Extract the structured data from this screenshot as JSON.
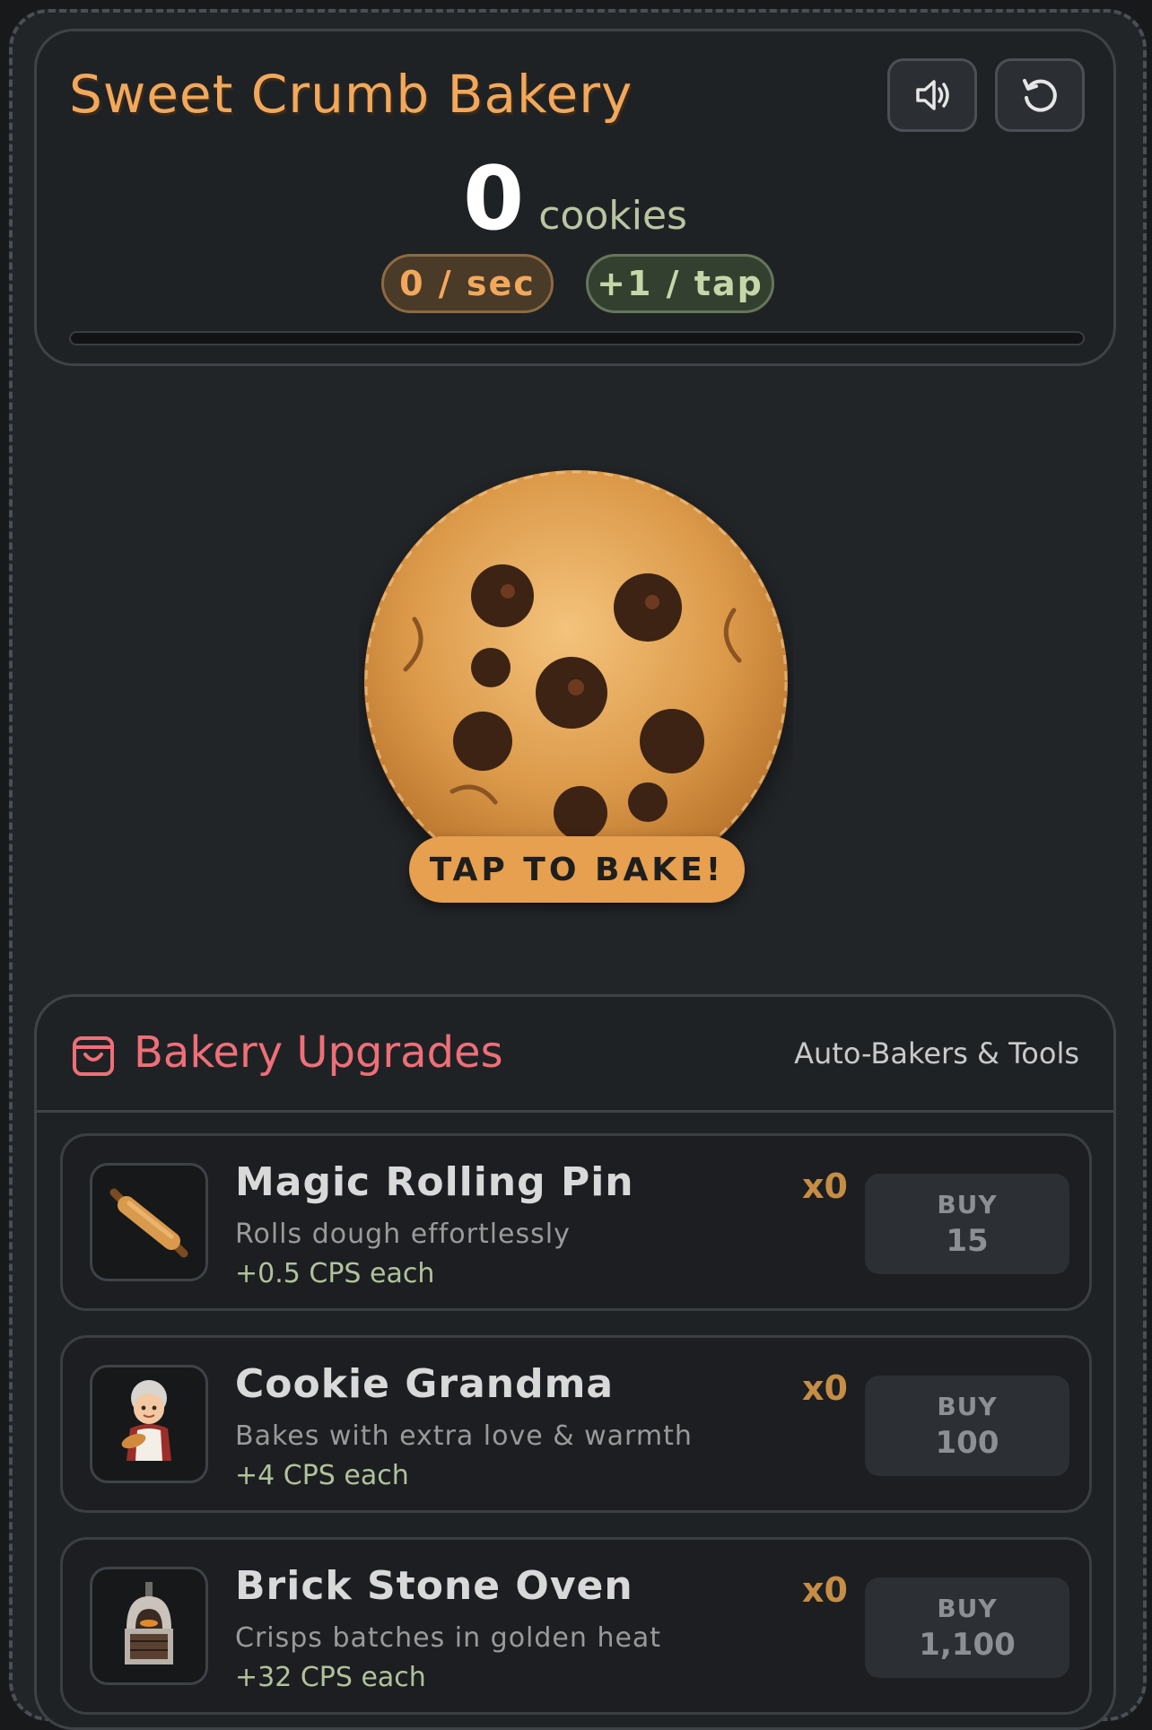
{
  "app": {
    "title": "Sweet Crumb Bakery"
  },
  "header": {
    "count": "0",
    "count_unit": "cookies",
    "per_second": "0 / sec",
    "per_tap": "+1 / tap",
    "progress": 0,
    "sound_icon": "speaker-icon",
    "reset_icon": "reset-icon"
  },
  "cookie": {
    "label": "TAP TO BAKE!"
  },
  "upgrades": {
    "title": "Bakery Upgrades",
    "subtitle": "Auto-Bakers & Tools",
    "items": [
      {
        "name": "Magic Rolling Pin",
        "desc": "Rolls dough effortlessly",
        "cps": "+0.5 CPS each",
        "count": "x0",
        "buy": "BUY",
        "price": "15",
        "icon": "rolling-pin-icon"
      },
      {
        "name": "Cookie Grandma",
        "desc": "Bakes with extra love & warmth",
        "cps": "+4 CPS each",
        "count": "x0",
        "buy": "BUY",
        "price": "100",
        "icon": "grandma-icon"
      },
      {
        "name": "Brick Stone Oven",
        "desc": "Crisps batches in golden heat",
        "cps": "+32 CPS each",
        "count": "x0",
        "buy": "BUY",
        "price": "1,100",
        "icon": "oven-icon"
      }
    ]
  },
  "colors": {
    "accent": "#f2a85b",
    "upgrades_title": "#ef6f78",
    "cps_green": "#b1c29a"
  }
}
